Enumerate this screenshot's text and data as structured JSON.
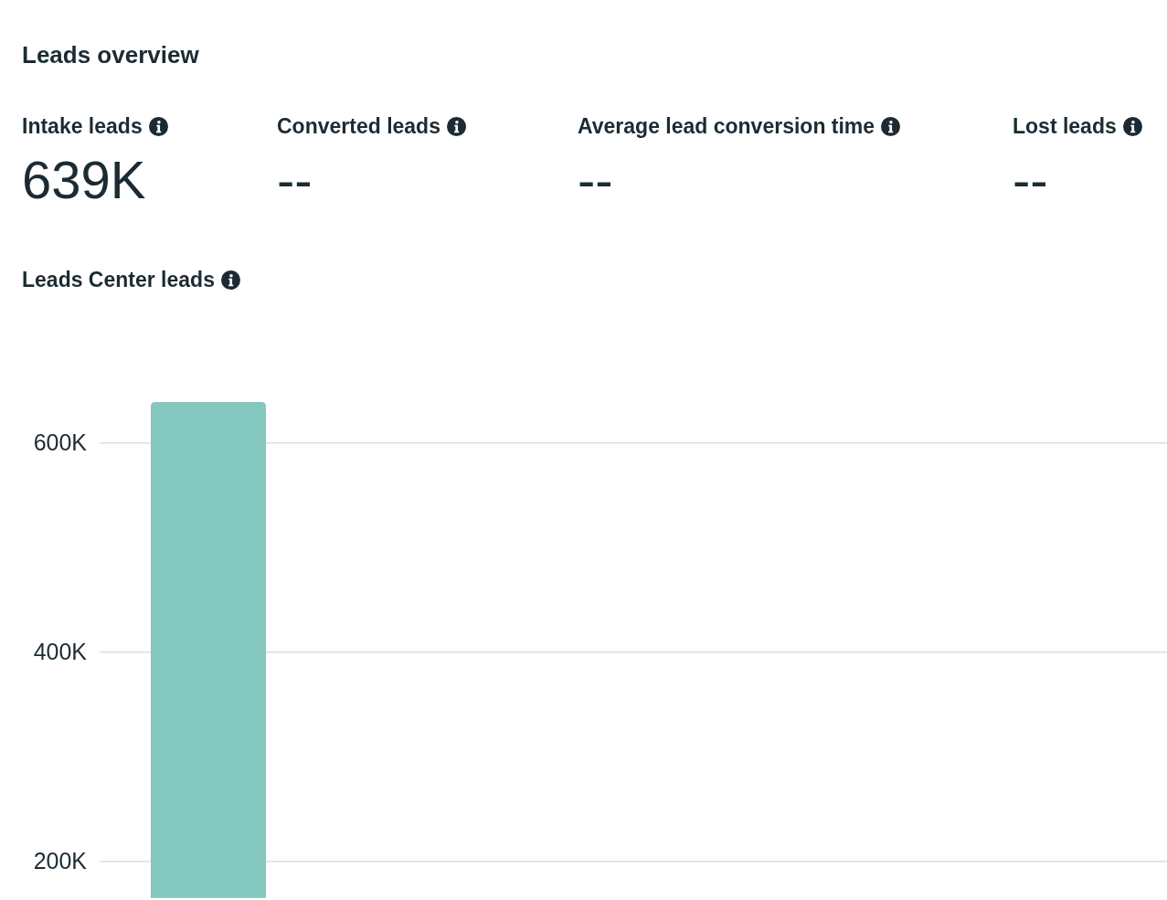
{
  "title": "Leads overview",
  "metrics": [
    {
      "label": "Intake leads",
      "value": "639K"
    },
    {
      "label": "Converted leads",
      "value": "--"
    },
    {
      "label": "Average lead conversion time",
      "value": "--"
    },
    {
      "label": "Lost leads",
      "value": "--"
    }
  ],
  "leads_center": {
    "title": "Leads Center leads",
    "chart_data": {
      "type": "bar",
      "values": [
        639000
      ],
      "ylim": [
        165000,
        639000
      ],
      "grid": true,
      "yticks": [
        {
          "value": 200000,
          "label": "200K"
        },
        {
          "value": 400000,
          "label": "400K"
        },
        {
          "value": 600000,
          "label": "600K"
        }
      ]
    }
  }
}
